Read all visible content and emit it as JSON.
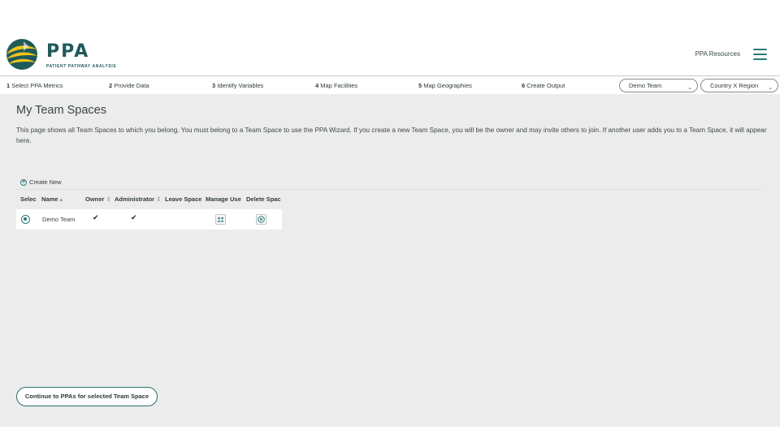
{
  "header": {
    "logo_title": "PPA",
    "logo_subtitle": "PATIENT PATHWAY ANALYSIS",
    "resources_link": "PPA Resources",
    "menu_icon": "hamburger-menu-icon"
  },
  "steps": [
    {
      "num": "1",
      "label": "Select PPA Metrics"
    },
    {
      "num": "2",
      "label": "Provide Data"
    },
    {
      "num": "3",
      "label": "Identify Variables"
    },
    {
      "num": "4",
      "label": "Map Facilities"
    },
    {
      "num": "5",
      "label": "Map Geographies"
    },
    {
      "num": "6",
      "label": "Create Output"
    }
  ],
  "selectors": {
    "team": "Demo Team",
    "region": "Country X Region"
  },
  "main": {
    "title": "My Team Spaces",
    "description": "This page shows all Team Spaces to which you belong. You must belong to a Team Space to use the PPA Wizard. If you create a new Team Space, you will be the owner and may invite others to join. If another user adds you to a Team Space, it will appear here.",
    "create_new": "Create New",
    "continue_button": "Continue to PPAs for selected Team Space"
  },
  "table": {
    "columns": [
      "Selec",
      "Name",
      "Owner",
      "Administrator",
      "Leave Space",
      "Manage Use",
      "Delete Spac"
    ],
    "sort_glyphs": {
      "name": "▴",
      "owner": "⇕",
      "administrator": "⇕"
    },
    "rows": [
      {
        "selected": true,
        "name": "Demo Team",
        "owner": "✔",
        "administrator": "✔",
        "leave_space": "",
        "manage_users": "users-icon",
        "delete_space": "delete-icon"
      }
    ]
  },
  "colors": {
    "accent": "#2b7a78",
    "brand_dark": "#1f5a5a",
    "logo_yellow": "#f2c31b",
    "background": "#ececec"
  }
}
